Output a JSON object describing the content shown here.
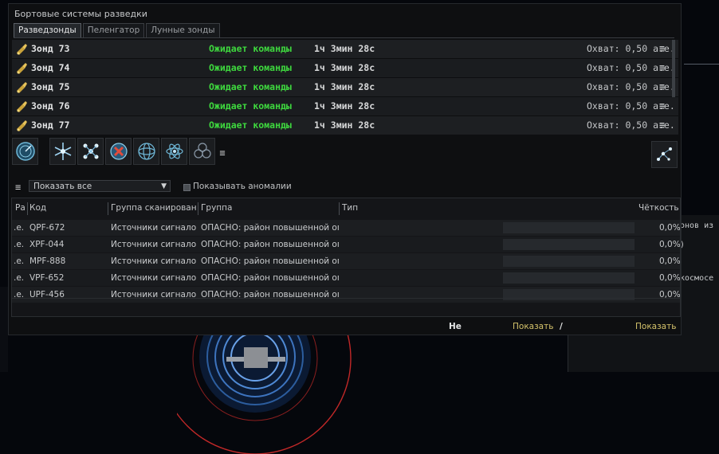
{
  "window": {
    "title": "Бортовые системы разведки",
    "tabs": [
      {
        "label": "Разведзонды",
        "active": true
      },
      {
        "label": "Пеленгатор",
        "active": false
      },
      {
        "label": "Лунные зонды",
        "active": false
      }
    ]
  },
  "probes": [
    {
      "name": "Зонд 73",
      "status": "Ожидает команды",
      "time": "1ч 3мин 28с",
      "range": "Охват: 0,50 а.е."
    },
    {
      "name": "Зонд 74",
      "status": "Ожидает команды",
      "time": "1ч 3мин 28с",
      "range": "Охват: 0,50 а.е."
    },
    {
      "name": "Зонд 75",
      "status": "Ожидает команды",
      "time": "1ч 3мин 28с",
      "range": "Охват: 0,50 а.е."
    },
    {
      "name": "Зонд 76",
      "status": "Ожидает команды",
      "time": "1ч 3мин 28с",
      "range": "Охват: 0,50 а.е."
    },
    {
      "name": "Зонд 77",
      "status": "Ожидает команды",
      "time": "1ч 3мин 28с",
      "range": "Охват: 0,50 а.е."
    }
  ],
  "toolbar_icons": [
    "analyze-icon",
    "snowflake-formation-icon",
    "pinpoint-formation-icon",
    "recall-probes-icon",
    "sphere-formation-icon",
    "atom-formation-icon",
    "triple-circle-icon"
  ],
  "filter": {
    "selected": "Показать все",
    "anomalies_label": "Показывать аномалии"
  },
  "columns": {
    "col0": "Ра",
    "code": "Код",
    "scan_group": "Группа сканирования",
    "group": "Группа",
    "type": "Тип",
    "signal": "Чёткость"
  },
  "results": [
    {
      "dist": ".е.",
      "code": "QPF-672",
      "scan_group": "Источники сигналов",
      "group": "ОПАСНО: район повышенной опа",
      "signal": "0,0%"
    },
    {
      "dist": ".е.",
      "code": "XPF-044",
      "scan_group": "Источники сигналов",
      "group": "ОПАСНО: район повышенной опа",
      "signal": "0,0%"
    },
    {
      "dist": ".е.",
      "code": "MPF-888",
      "scan_group": "Источники сигналов",
      "group": "ОПАСНО: район повышенной опа",
      "signal": "0,0%"
    },
    {
      "dist": ".е.",
      "code": "VPF-652",
      "scan_group": "Источники сигналов",
      "group": "ОПАСНО: район повышенной опа",
      "signal": "0,0%"
    },
    {
      "dist": ".е.",
      "code": "UPF-456",
      "scan_group": "Источники сигналов",
      "group": "ОПАСНО: район повышенной опа",
      "signal": "0,0%"
    }
  ],
  "footer": {
    "no": "Не",
    "show1": "Показать",
    "slash": "/",
    "show2": "Показать"
  },
  "background": {
    "line1": "онов из",
    "line2": ")",
    "line3": "космосе"
  },
  "colors": {
    "status_green": "#3ed83e",
    "link_gold": "#d4c26a"
  }
}
